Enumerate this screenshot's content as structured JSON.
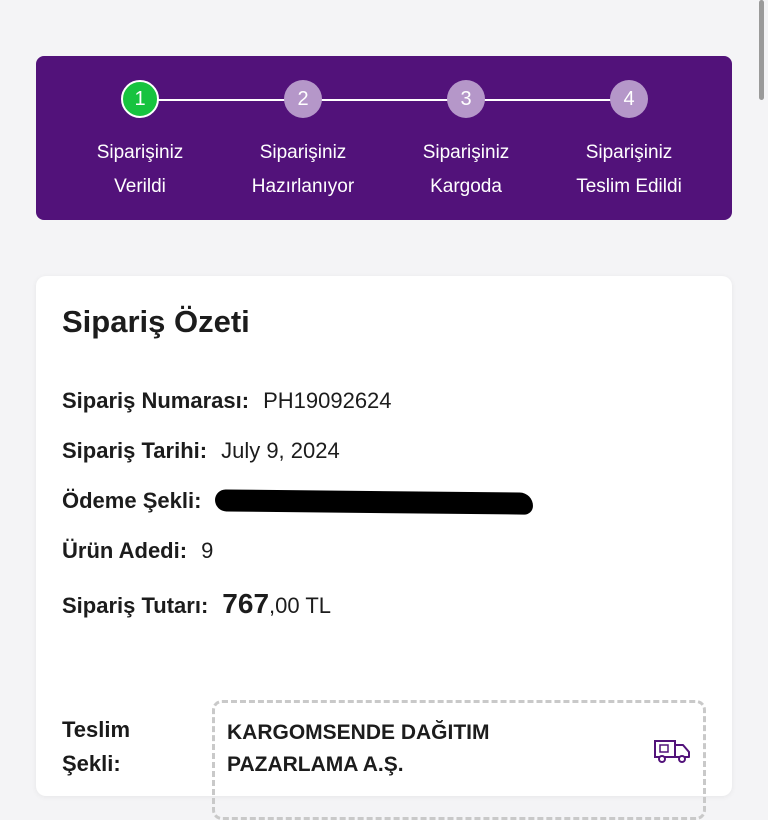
{
  "stepper": {
    "steps": [
      {
        "number": "1",
        "line1": "Siparişiniz",
        "line2": "Verildi",
        "state": "active"
      },
      {
        "number": "2",
        "line1": "Siparişiniz",
        "line2": "Hazırlanıyor",
        "state": "pending"
      },
      {
        "number": "3",
        "line1": "Siparişiniz",
        "line2": "Kargoda",
        "state": "pending"
      },
      {
        "number": "4",
        "line1": "Siparişiniz",
        "line2": "Teslim Edildi",
        "state": "pending"
      }
    ],
    "colors": {
      "background": "#52127a",
      "active": "#17c33f",
      "pending": "#b597c9"
    }
  },
  "summary": {
    "title": "Sipariş Özeti",
    "order_number_label": "Sipariş Numarası:",
    "order_number": "PH19092624",
    "order_date_label": "Sipariş Tarihi:",
    "order_date": "July 9, 2024",
    "payment_label": "Ödeme Şekli:",
    "item_count_label": "Ürün Adedi:",
    "item_count": "9",
    "total_label": "Sipariş Tutarı:",
    "total_main": "767",
    "total_rest": ",00 TL",
    "delivery_label_line1": "Teslim",
    "delivery_label_line2": "Şekli:",
    "courier_line1": "KARGOMSENDE DAĞITIM",
    "courier_line2": "PAZARLAMA A.Ş."
  },
  "icons": {
    "delivery": "delivery-truck-icon"
  }
}
